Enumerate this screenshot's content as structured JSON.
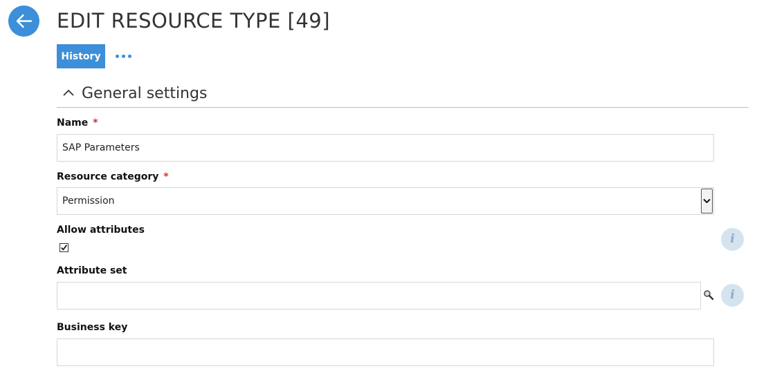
{
  "header": {
    "title": "EDIT RESOURCE TYPE [49]",
    "back_icon": "arrow-left-icon"
  },
  "toolbar": {
    "history_label": "History",
    "more_icon": "more-horizontal-icon"
  },
  "section": {
    "title": "General settings",
    "collapse_icon": "chevron-up-icon",
    "expanded": true
  },
  "form": {
    "name": {
      "label": "Name",
      "required_mark": "*",
      "value": "SAP Parameters"
    },
    "resource_category": {
      "label": "Resource category",
      "required_mark": "*",
      "selected": "Permission"
    },
    "allow_attributes": {
      "label": "Allow attributes",
      "checked": true,
      "info_icon": "i"
    },
    "attribute_set": {
      "label": "Attribute set",
      "value": "",
      "search_icon": "magnifier-icon",
      "info_icon": "i"
    },
    "business_key": {
      "label": "Business key",
      "value": ""
    }
  },
  "colors": {
    "accent": "#3d8fd9",
    "required": "#d32f2f",
    "info_bg": "#d5e3ef"
  }
}
